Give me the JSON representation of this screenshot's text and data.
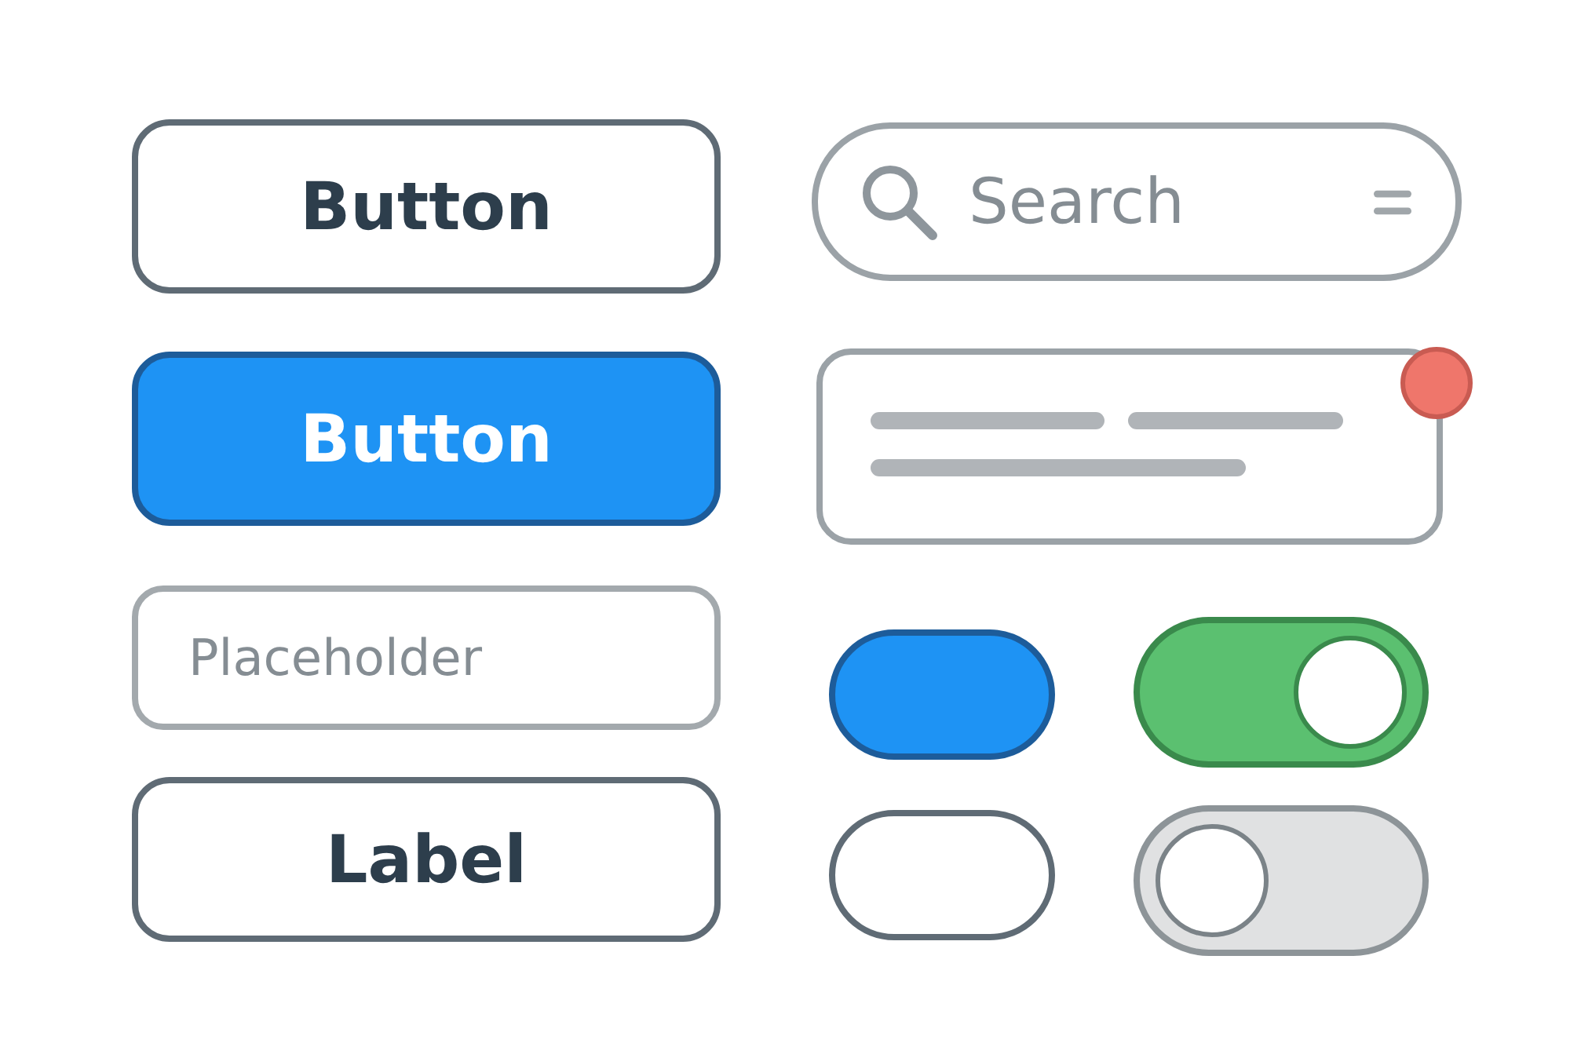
{
  "buttons": [
    {
      "label": "Button",
      "kind": "outline"
    },
    {
      "label": "Button",
      "kind": "filled"
    }
  ],
  "input": {
    "placeholder": "Placeholder"
  },
  "label_button": {
    "label": "Label"
  },
  "search": {
    "placeholder": "Search"
  },
  "card": {
    "notification": true
  },
  "pills": [
    {
      "selected": true
    },
    {
      "selected": false
    }
  ],
  "toggles": [
    {
      "on": true
    },
    {
      "on": false
    }
  ]
}
